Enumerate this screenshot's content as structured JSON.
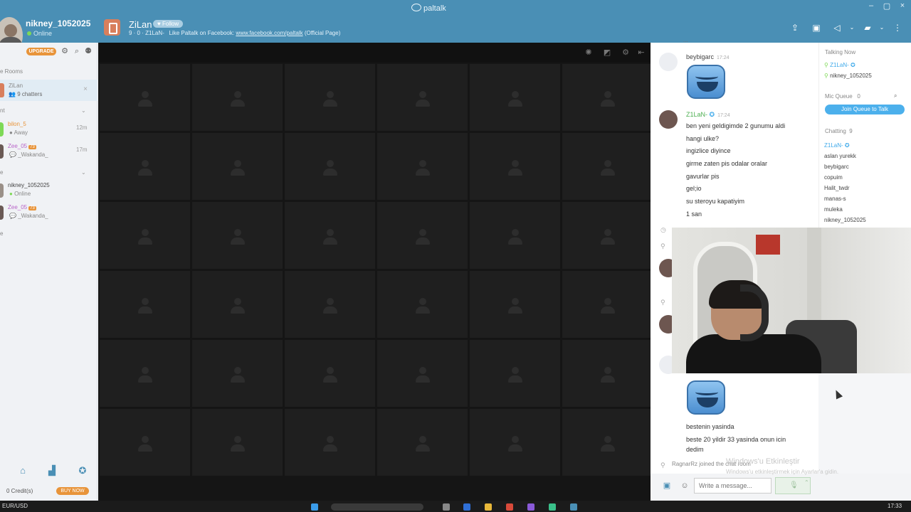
{
  "titlebar": {
    "brand": "paltalk",
    "user_name": "nikney_1052025",
    "user_status": "Online",
    "room_title": "ZiLan",
    "follow_label": "Follow",
    "room_stats": "9  ·  0  ·  Z1LaN-",
    "facebook_text": "Like Paltalk on Facebook:",
    "facebook_link": "www.facebook.com/paltalk",
    "facebook_suffix": "(Official Page)",
    "window_controls": [
      "–",
      "▢",
      "×"
    ]
  },
  "sidebar": {
    "upgrade_label": "UPGRADE",
    "rooms_label": "e Rooms",
    "active_room": {
      "name": "ZiLan",
      "chatters": "9 chatters"
    },
    "section2_label": "nt",
    "contacts": [
      {
        "name": "bilon_5",
        "status": "Away",
        "time": "12m",
        "color": "#e8943a"
      },
      {
        "name": "Zee_05",
        "status": "_Wakanda_",
        "time": "17m",
        "color": "#b864c8",
        "badge": "73"
      }
    ],
    "section3_label": "e",
    "contacts2": [
      {
        "name": "nikney_1052025",
        "status": "Online",
        "color": "#444"
      },
      {
        "name": "Zee_05",
        "status": "_Wakanda_",
        "color": "#b864c8",
        "badge": "73"
      }
    ],
    "section4_label": "e",
    "credits": "0 Credit(s)",
    "buy_now": "BUY NOW"
  },
  "chat": {
    "top_cut": "...",
    "messages": [
      {
        "author": "beybigarc",
        "time": "17:24",
        "author_color": "#555",
        "lines": []
      },
      {
        "author": "Z1LaN-",
        "time": "17:24",
        "author_color": "#4caf50",
        "lines": [
          "ben yeni geldigimde 2 gunumu aldi",
          "hangi ulke?",
          "ingizlice diyince",
          "girme zaten pis odalar oralar",
          "gavurlar pis",
          "gel;io",
          "su steroyu kapatiyim",
          "1 san"
        ]
      }
    ],
    "lines_bottom": [
      "bestenin yasinda",
      "beste 20 yildir 33 yasinda onun icin",
      "dedim"
    ],
    "system_message": "RagnarRz joined the chat room",
    "input_placeholder": "Write a message...",
    "watermark_title": "Windows'u Etkinleştir",
    "watermark_sub": "Windows'u etkinleştirmek için Ayarlar'a gidin."
  },
  "right_panel": {
    "talking_now_label": "Talking Now",
    "talking_now": [
      "Z1LaN-",
      "nikney_1052025"
    ],
    "mic_queue_label": "Mic Queue",
    "mic_queue_count": "0",
    "join_queue_label": "Join Queue to Talk",
    "chatting_label": "Chatting",
    "chatting_count": "9",
    "chatting": [
      "Z1LaN-",
      "aslan yurekk",
      "beybigarc",
      "copuim",
      "Halit_twdr",
      "manas-s",
      "muleka",
      "nikney_1052025"
    ]
  },
  "taskbar": {
    "left_text": "EUR/USD",
    "time": "17:33"
  }
}
